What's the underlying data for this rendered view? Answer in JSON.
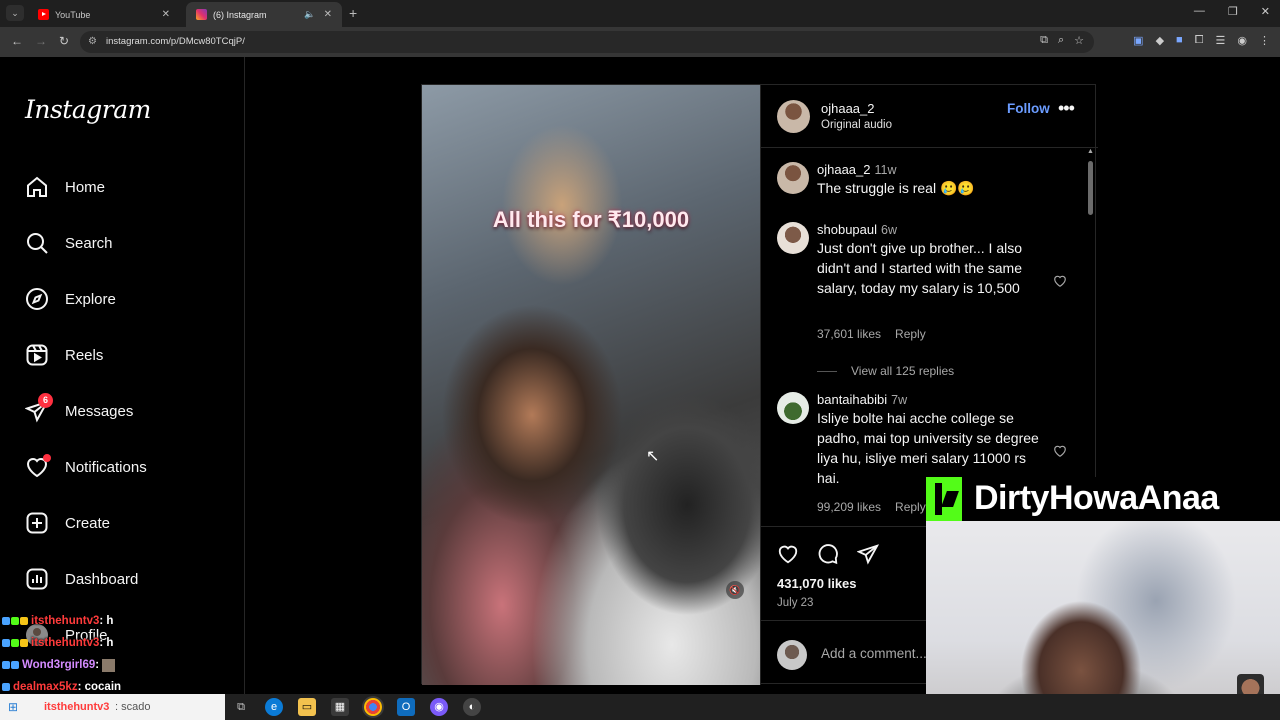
{
  "browser": {
    "tabs": [
      {
        "title": "YouTube",
        "active": false
      },
      {
        "title": "(6) Instagram",
        "active": true
      }
    ],
    "url": "instagram.com/p/DMcw80TCqjP/"
  },
  "sidebar": {
    "logo": "Instagram",
    "items": [
      {
        "label": "Home",
        "icon": "home-icon"
      },
      {
        "label": "Search",
        "icon": "search-icon"
      },
      {
        "label": "Explore",
        "icon": "compass-icon"
      },
      {
        "label": "Reels",
        "icon": "reels-icon"
      },
      {
        "label": "Messages",
        "icon": "messenger-icon",
        "badge": "6"
      },
      {
        "label": "Notifications",
        "icon": "heart-icon",
        "dot": true
      },
      {
        "label": "Create",
        "icon": "plus-square-icon"
      },
      {
        "label": "Dashboard",
        "icon": "chart-icon"
      },
      {
        "label": "Profile",
        "icon": "avatar"
      }
    ]
  },
  "post": {
    "media_caption": "All this for ₹10,000",
    "author": "ojhaaa_2",
    "audio": "Original audio",
    "follow_label": "Follow",
    "likes": "431,070 likes",
    "date": "July 23",
    "add_comment_placeholder": "Add a comment...",
    "comments": [
      {
        "user": "ojhaaa_2",
        "time": "11w",
        "text": "The struggle is real 🥲🥲"
      },
      {
        "user": "shobupaul",
        "time": "6w",
        "text": "Just don't give up brother... I also didn't and I started with the same salary, today my salary is 10,500",
        "likes": "37,601 likes",
        "reply": "Reply",
        "view_replies": "View all 125 replies"
      },
      {
        "user": "bantaihabibi",
        "time": "7w",
        "text": "Isliye bolte hai acche college se padho, mai top university se degree liya hu, isliye meri salary 11000 rs hai.",
        "likes": "99,209 likes",
        "reply": "Reply"
      }
    ]
  },
  "stream": {
    "brand": "DirtyHowaAnaa",
    "brand_color": "#53fc18",
    "chat": [
      {
        "user": "itsthehuntv3",
        "msg": ": h",
        "color": "#ff3b3b"
      },
      {
        "user": "itsthehuntv3",
        "msg": ": h",
        "color": "#ff3b3b"
      },
      {
        "user": "Wond3rgirl69",
        "msg": ":",
        "color": "#d48bff"
      },
      {
        "user": "dealmax5kz",
        "msg": ": cocain",
        "color": "#ff3b3b"
      },
      {
        "user": "itsthehuntv3",
        "msg": ": scado",
        "color": "#ff3b3b"
      }
    ]
  },
  "colors": {
    "follow": "#6b9cff",
    "badge": "#ff3040",
    "background": "#000000"
  }
}
